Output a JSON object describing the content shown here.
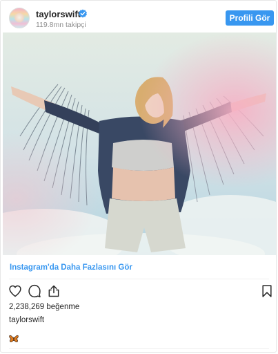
{
  "header": {
    "username": "taylorswift",
    "followers": "119.8mn takipçi",
    "profile_button": "Profili Gör",
    "verified_icon": "verified-badge-icon",
    "accent_color": "#3897f0"
  },
  "post": {
    "see_more": "Instagram'da Daha Fazlasını Gör",
    "likes": "2,238,269 beğenme",
    "caption_user": "taylorswift",
    "caption_emoji": "butterfly-icon"
  },
  "actions": {
    "icons": [
      "heart-icon",
      "comment-icon",
      "share-icon",
      "bookmark-icon"
    ]
  }
}
